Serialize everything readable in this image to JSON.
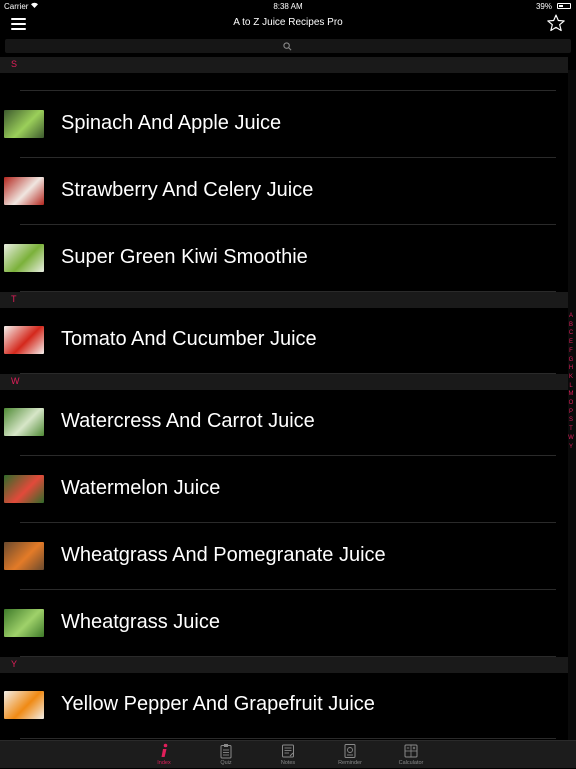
{
  "status_bar": {
    "carrier": "Carrier",
    "time": "8:38 AM",
    "battery": "39%",
    "battery_level": 0.39
  },
  "header": {
    "title": "A to Z Juice Recipes Pro"
  },
  "search": {
    "icon": "search-icon"
  },
  "sections": [
    {
      "letter": "S",
      "items": [
        {
          "name": "Spinach And Apple Juice",
          "thumb_colors": [
            "#3d5a2e",
            "#9bcf5a"
          ]
        },
        {
          "name": "Strawberry And Celery Juice",
          "thumb_colors": [
            "#b3261e",
            "#f0e6e0"
          ]
        },
        {
          "name": "Super Green Kiwi Smoothie",
          "thumb_colors": [
            "#e9eee2",
            "#7bb13a"
          ]
        }
      ]
    },
    {
      "letter": "T",
      "items": [
        {
          "name": "Tomato And Cucumber Juice",
          "thumb_colors": [
            "#f4f1ee",
            "#d4281c"
          ]
        }
      ]
    },
    {
      "letter": "W",
      "items": [
        {
          "name": "Watercress And Carrot Juice",
          "thumb_colors": [
            "#4f8a35",
            "#d7e6c8"
          ]
        },
        {
          "name": "Watermelon Juice",
          "thumb_colors": [
            "#2f6b2a",
            "#e24a3a"
          ]
        },
        {
          "name": "Wheatgrass And Pomegranate Juice",
          "thumb_colors": [
            "#6b4a2e",
            "#e37b28"
          ]
        },
        {
          "name": "Wheatgrass Juice",
          "thumb_colors": [
            "#3e7a2a",
            "#9fd16a"
          ]
        }
      ]
    },
    {
      "letter": "Y",
      "items": [
        {
          "name": "Yellow Pepper And Grapefruit Juice",
          "thumb_colors": [
            "#f2efe9",
            "#f08a14"
          ]
        }
      ]
    }
  ],
  "index_letters": [
    "A",
    "B",
    "C",
    "E",
    "F",
    "G",
    "H",
    "K",
    "L",
    "M",
    "O",
    "P",
    "S",
    "T",
    "W",
    "Y"
  ],
  "tabs": [
    {
      "label": "Index",
      "icon": "info-icon",
      "active": true
    },
    {
      "label": "Quiz",
      "icon": "clipboard-icon",
      "active": false
    },
    {
      "label": "Notes",
      "icon": "notes-icon",
      "active": false
    },
    {
      "label": "Reminder",
      "icon": "reminder-icon",
      "active": false
    },
    {
      "label": "Calculator",
      "icon": "calculator-icon",
      "active": false
    }
  ],
  "colors": {
    "accent": "#e01f5a",
    "background": "#000000",
    "section_header": "#1a1a1a"
  }
}
